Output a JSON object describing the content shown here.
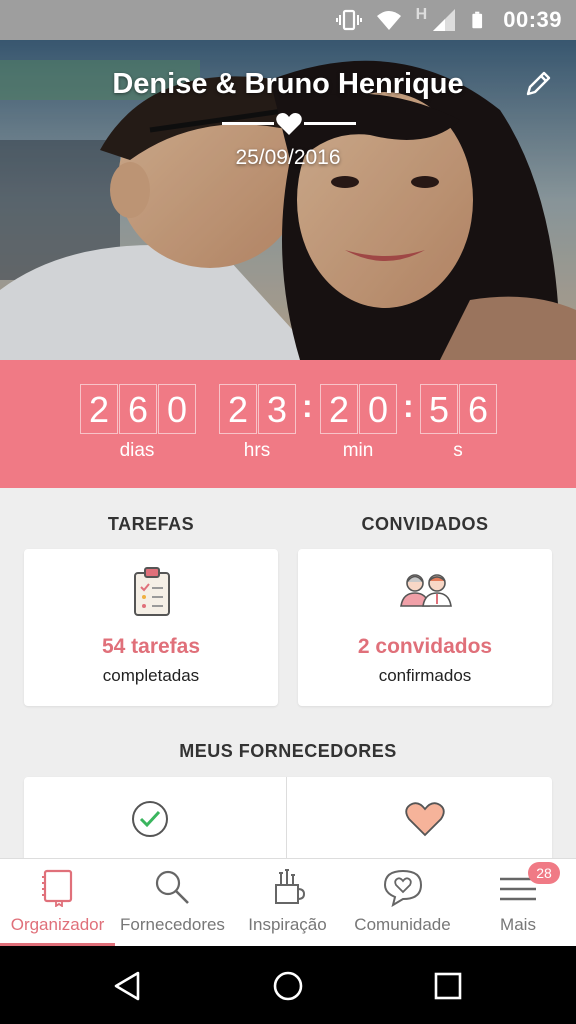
{
  "status_bar": {
    "time": "00:39",
    "network": "H"
  },
  "hero": {
    "couple_names": "Denise & Bruno Henrique",
    "date": "25/09/2016"
  },
  "countdown": {
    "days": [
      "2",
      "6",
      "0"
    ],
    "hours": [
      "2",
      "3"
    ],
    "minutes": [
      "2",
      "0"
    ],
    "seconds": [
      "5",
      "6"
    ],
    "labels": {
      "days": "dias",
      "hours": "hrs",
      "minutes": "min",
      "seconds": "s"
    }
  },
  "tasks": {
    "title": "TAREFAS",
    "count_text": "54 tarefas",
    "sub_text": "completadas"
  },
  "guests": {
    "title": "CONVIDADOS",
    "count_text": "2 convidados",
    "sub_text": "confirmados"
  },
  "vendors": {
    "title": "MEUS FORNECEDORES"
  },
  "bottom_nav": {
    "items": [
      {
        "label": "Organizador",
        "icon": "notebook-icon",
        "active": true
      },
      {
        "label": "Fornecedores",
        "icon": "search-icon",
        "active": false
      },
      {
        "label": "Inspiração",
        "icon": "brushes-icon",
        "active": false
      },
      {
        "label": "Comunidade",
        "icon": "chat-heart-icon",
        "active": false
      },
      {
        "label": "Mais",
        "icon": "menu-icon",
        "active": false
      }
    ],
    "badge": "28"
  },
  "colors": {
    "accent": "#f07a85",
    "accent_text": "#e0707a"
  }
}
